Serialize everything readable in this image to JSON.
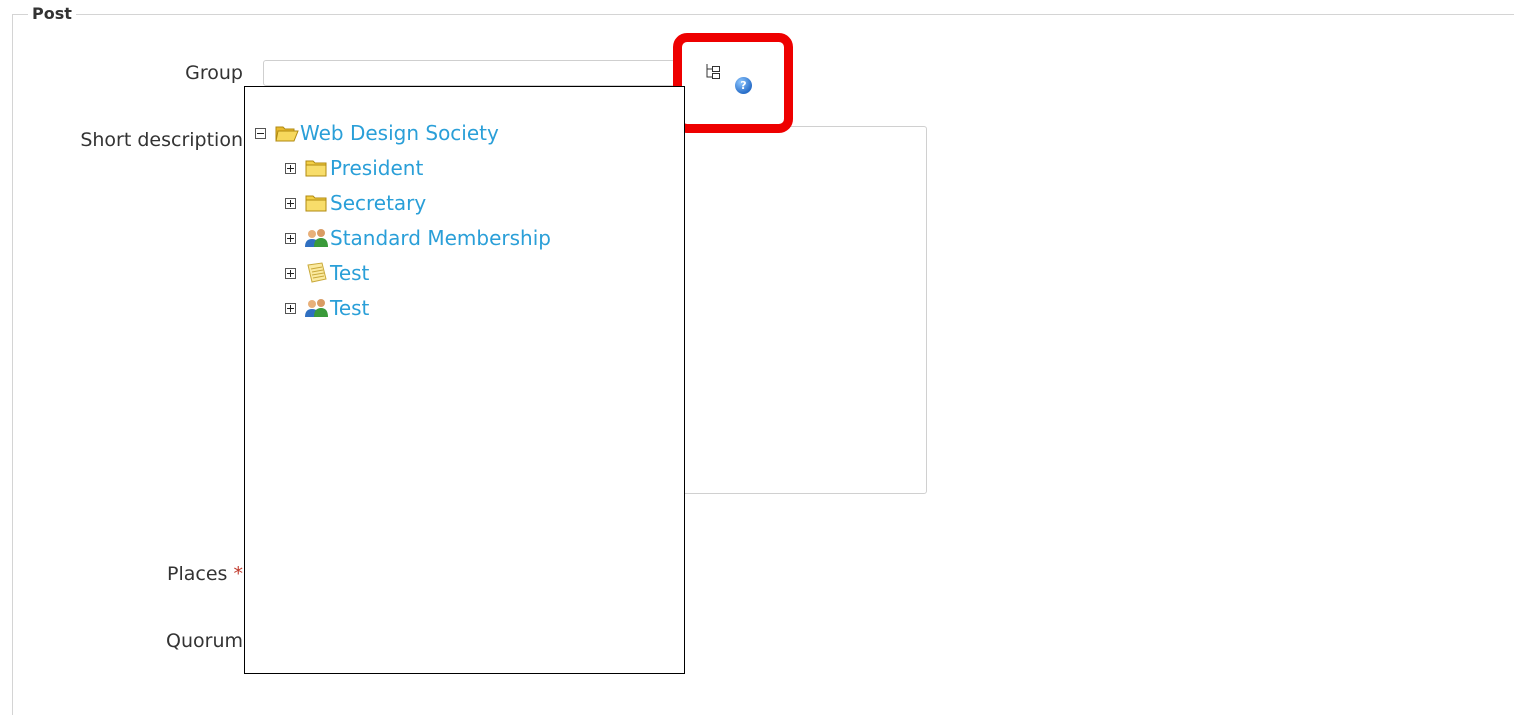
{
  "fieldset": {
    "legend": "Post"
  },
  "form": {
    "group_label": "Group",
    "group_value": "",
    "short_description_label": "Short description",
    "places_label": "Places",
    "places_required": "*",
    "quorum_label": "Quorum"
  },
  "buttons": {
    "tree_icon": "tree-icon",
    "help_icon": "help-icon",
    "help_glyph": "?"
  },
  "tree": {
    "root": {
      "label": "Web Design Society",
      "icon": "folder-open-icon",
      "expanded": true
    },
    "children": [
      {
        "label": "President",
        "icon": "folder-icon"
      },
      {
        "label": "Secretary",
        "icon": "folder-icon"
      },
      {
        "label": "Standard Membership",
        "icon": "users-icon"
      },
      {
        "label": "Test",
        "icon": "document-icon"
      },
      {
        "label": "Test",
        "icon": "users-icon"
      }
    ]
  },
  "colors": {
    "link": "#2a9fd8",
    "highlight": "#ee0000",
    "required": "#c0392b"
  }
}
